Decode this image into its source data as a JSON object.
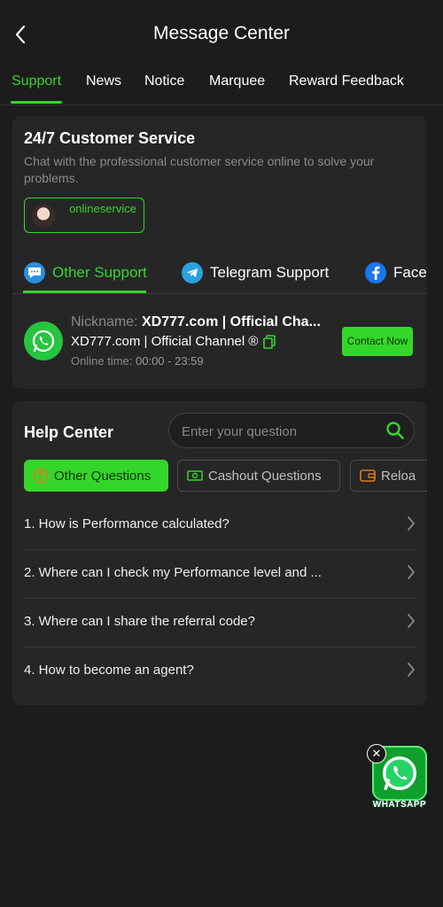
{
  "header": {
    "title": "Message Center"
  },
  "tabs": [
    "Support",
    "News",
    "Notice",
    "Marquee",
    "Reward Feedback"
  ],
  "customer_service": {
    "title": "24/7 Customer Service",
    "description": "Chat with the professional customer service online to solve your problems.",
    "online_label": "onlineservice"
  },
  "support_tabs": [
    "Other Support",
    "Telegram Support",
    "Facel"
  ],
  "channel": {
    "nickname_label": "Nickname:",
    "nickname_value": "XD777.com | Official Cha...",
    "name": "XD777.com | Official Channel ®",
    "online_time_label": "Online time:",
    "online_time_value": "00:00 - 23:59",
    "contact_label": "Contact Now"
  },
  "help": {
    "title": "Help Center",
    "search_placeholder": "Enter your question",
    "question_tabs": [
      "Other Questions",
      "Cashout Questions",
      "Reloa"
    ],
    "faqs": [
      "1. How is Performance calculated?",
      "2. Where can I check my Performance level and ...",
      "3. Where can I share the referral code?",
      "4. How to become an agent?"
    ]
  },
  "floating": {
    "label": "WHATSAPP"
  },
  "colors": {
    "accent": "#35d62a",
    "background": "#1c1c1c",
    "card": "#262626"
  }
}
